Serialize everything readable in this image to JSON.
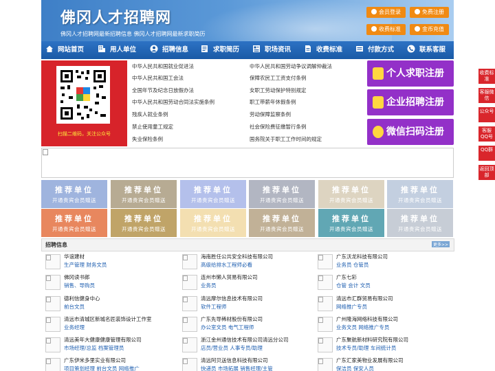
{
  "header": {
    "title": "佛冈人才招聘网",
    "subtitle": "佛冈人才招聘网最新招聘信息   佛冈人才招聘网最新求职简历",
    "buttons": {
      "login": "会员登录",
      "register": "免费注册",
      "pricing": "收费标准",
      "recharge": "金币充值"
    }
  },
  "nav": {
    "items": [
      {
        "label": "网站首页",
        "icon": "home-icon"
      },
      {
        "label": "用人单位",
        "icon": "building-icon"
      },
      {
        "label": "招聘信息",
        "icon": "user-icon"
      },
      {
        "label": "求职简历",
        "icon": "resume-icon"
      },
      {
        "label": "职场资讯",
        "icon": "news-icon"
      },
      {
        "label": "收费标准",
        "icon": "document-icon"
      },
      {
        "label": "付款方式",
        "icon": "payment-icon"
      },
      {
        "label": "联系客服",
        "icon": "phone-icon"
      }
    ]
  },
  "qr": {
    "caption": "扫描二维码，关注公众号"
  },
  "policies": {
    "left": [
      "中华人民共和国就业促进法",
      "中华人民共和国工会法",
      "全国年节及纪念日放假办法",
      "中华人民共和国劳动合同法实施条例",
      "残疾人就业条例",
      "禁止使用童工规定",
      "失业保险条例"
    ],
    "right": [
      "中华人民共和国劳动争议调解仲裁法",
      "保障农民工工资支付条例",
      "女职工劳动保护特别规定",
      "职工带薪年休假条例",
      "劳动保障监察条例",
      "社会保险费征缴暂行条例",
      "国务院关于职工工作时间的规定"
    ]
  },
  "register": {
    "jobseeker": "个人求职注册",
    "company": "企业招聘注册",
    "wechat": "微信扫码注册"
  },
  "sidebar": [
    "收费标准",
    "客服微信",
    "公众号",
    "客服QQ号",
    "QQ群",
    "返回顶部"
  ],
  "tiles": {
    "title": "推荐单位",
    "sub": "开通贵宾会员赠送",
    "colors": [
      "#9fb4de",
      "#b7ab93",
      "#b4c0eb",
      "#b2b6c2",
      "#ddd4c1",
      "#c3cfe0",
      "#e8875e",
      "#c0a468",
      "#f3dfb1",
      "#c1b197",
      "#61a7b4",
      "#c7cdd6"
    ]
  },
  "jobs": {
    "heading": "招聘信息",
    "more": "更多>>",
    "rows": [
      [
        {
          "company": "华谊建材",
          "positions": "生产管理 财务文员"
        },
        {
          "company": "海南胜任公共安全科技有限公司",
          "positions": "高级给排水工程师必看"
        },
        {
          "company": "广东沃龙科技有限公司",
          "positions": "业务员 仓管员"
        }
      ],
      [
        {
          "company": "佛冈读书郎",
          "positions": "销售、导购员"
        },
        {
          "company": "连州市懒人贸易有限公司",
          "positions": "业务员"
        },
        {
          "company": "广东七彩",
          "positions": "仓管 会计 文员"
        }
      ],
      [
        {
          "company": "德利信健身中心",
          "positions": "前台文员"
        },
        {
          "company": "清远摩尔信息技术有限公司",
          "positions": "软件工程师"
        },
        {
          "company": "清远市汇群贸易有限公司",
          "positions": "网络推广专员"
        }
      ],
      [
        {
          "company": "清远市清城区新城名匠装饰设计工作室",
          "positions": "业务经理"
        },
        {
          "company": "广东先导稀材股份有限公司",
          "positions": "办公室文员 电气工程师"
        },
        {
          "company": "广州隆海网络科技有限公司",
          "positions": "业务文员 网络推广专员"
        }
      ],
      [
        {
          "company": "清远美年大健康健康管理有限公司",
          "positions": "市场经理/总监 档案管理员"
        },
        {
          "company": "浙江金州通信技术有限公司清远分公司",
          "positions": "店员/营业员 人事专员/助理"
        },
        {
          "company": "广东聚航新材料研究院有限公司",
          "positions": "技术专员/助理 车间统计员"
        }
      ],
      [
        {
          "company": "广东伊米多里实业有限公司",
          "positions": "项目策划经理 前台文员 网络推广"
        },
        {
          "company": "清远阿贝送信息科技有限公司",
          "positions": "快递员 市场拓展 销售经理/主管"
        },
        {
          "company": "广东汇家美物业发展有限公司",
          "positions": "保洁员 保安人员"
        }
      ]
    ]
  }
}
